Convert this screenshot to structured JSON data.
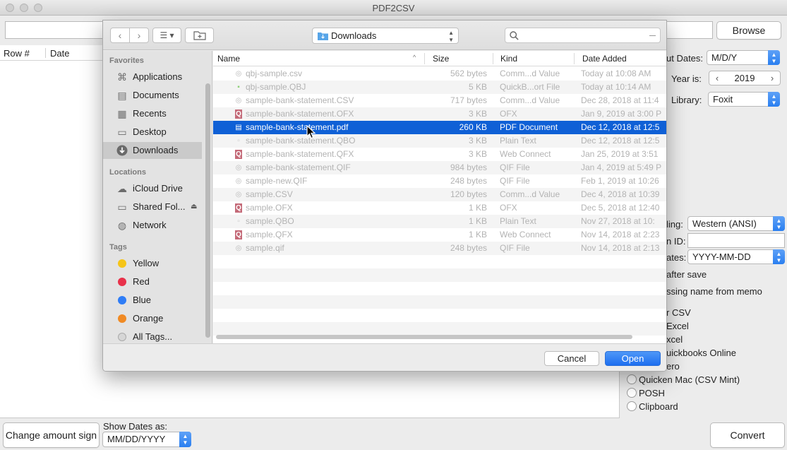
{
  "app": {
    "title": "PDF2CSV",
    "browse_label": "Browse",
    "grid_columns": [
      "Row #",
      "Date"
    ],
    "change_amount_sign_label": "Change amount sign",
    "show_dates_as_label": "Show Dates as:",
    "show_dates_as_value": "MM/DD/YYYY",
    "convert_label": "Convert",
    "settings": {
      "input_dates_label": "ut Dates:",
      "input_dates_value": "M/D/Y",
      "year_label": "Year is:",
      "year_value": "2019",
      "library_label": "Library:",
      "library_value": "Foxit",
      "encoding_label": "ling:",
      "encoding_value": "Western (ANSI)",
      "id_label": "n ID:",
      "id_value": "",
      "dates_label": "ates:",
      "dates_value": "YYYY-MM-DD",
      "after_save_label": "after save",
      "missing_name_label": "ssing name from memo"
    },
    "output_options": [
      "r CSV",
      "Excel",
      "xcel",
      "uickbooks Online",
      "ero",
      "Quicken Mac (CSV Mint)",
      "POSH",
      "Clipboard"
    ]
  },
  "dialog": {
    "location": "Downloads",
    "search_placeholder": "",
    "sidebar": {
      "favorites_title": "Favorites",
      "favorites": [
        {
          "label": "Applications",
          "icon": "applications-icon"
        },
        {
          "label": "Documents",
          "icon": "documents-icon"
        },
        {
          "label": "Recents",
          "icon": "recents-icon"
        },
        {
          "label": "Desktop",
          "icon": "desktop-icon"
        },
        {
          "label": "Downloads",
          "icon": "downloads-icon",
          "selected": true
        }
      ],
      "locations_title": "Locations",
      "locations": [
        {
          "label": "iCloud Drive",
          "icon": "cloud-icon"
        },
        {
          "label": "Shared Fol...",
          "icon": "display-icon"
        },
        {
          "label": "Network",
          "icon": "globe-icon"
        }
      ],
      "tags_title": "Tags",
      "tags": [
        {
          "label": "Yellow",
          "color": "#f5c518"
        },
        {
          "label": "Red",
          "color": "#e8314a"
        },
        {
          "label": "Blue",
          "color": "#2f7df6"
        },
        {
          "label": "Orange",
          "color": "#f08a24"
        },
        {
          "label": "All Tags...",
          "color": "#d6d6d6"
        }
      ]
    },
    "columns": {
      "name": "Name",
      "size": "Size",
      "kind": "Kind",
      "date": "Date Added"
    },
    "files": [
      {
        "name": "qbj-sample.csv",
        "size": "562 bytes",
        "kind": "Comm...d Value",
        "date": "Today at 10:08 AM",
        "icon": "csv-file-icon"
      },
      {
        "name": "qbj-sample.QBJ",
        "size": "5 KB",
        "kind": "QuickB...ort File",
        "date": "Today at 10:14 AM",
        "icon": "qbj-file-icon"
      },
      {
        "name": "sample-bank-statement.CSV",
        "size": "717 bytes",
        "kind": "Comm...d Value",
        "date": "Dec 28, 2018 at 11:4",
        "icon": "csv-file-icon"
      },
      {
        "name": "sample-bank-statement.OFX",
        "size": "3 KB",
        "kind": "OFX",
        "date": "Jan 9, 2019 at 3:00 P",
        "icon": "quicken-file-icon"
      },
      {
        "name": "sample-bank-statement.pdf",
        "size": "260 KB",
        "kind": "PDF Document",
        "date": "Dec 12, 2018 at 12:5",
        "icon": "pdf-file-icon",
        "selected": true
      },
      {
        "name": "sample-bank-statement.QBO",
        "size": "3 KB",
        "kind": "Plain Text",
        "date": "Dec 12, 2018 at 12:5",
        "icon": "text-file-icon"
      },
      {
        "name": "sample-bank-statement.QFX",
        "size": "3 KB",
        "kind": "Web Connect",
        "date": "Jan 25, 2019 at 3:51",
        "icon": "quicken-file-icon"
      },
      {
        "name": "sample-bank-statement.QIF",
        "size": "984 bytes",
        "kind": "QIF File",
        "date": "Jan 4, 2019 at 5:49 P",
        "icon": "csv-file-icon"
      },
      {
        "name": "sample-new.QIF",
        "size": "248 bytes",
        "kind": "QIF File",
        "date": "Feb 1, 2019 at 10:26",
        "icon": "csv-file-icon"
      },
      {
        "name": "sample.CSV",
        "size": "120 bytes",
        "kind": "Comm...d Value",
        "date": "Dec 4, 2018 at 10:39",
        "icon": "csv-file-icon"
      },
      {
        "name": "sample.OFX",
        "size": "1 KB",
        "kind": "OFX",
        "date": "Dec 5, 2018 at 12:40",
        "icon": "quicken-file-icon"
      },
      {
        "name": "sample.QBO",
        "size": "1 KB",
        "kind": "Plain Text",
        "date": "Nov 27, 2018 at 10:",
        "icon": "text-file-icon"
      },
      {
        "name": "sample.QFX",
        "size": "1 KB",
        "kind": "Web Connect",
        "date": "Nov 14, 2018 at 2:23",
        "icon": "quicken-file-icon"
      },
      {
        "name": "sample.qif",
        "size": "248 bytes",
        "kind": "QIF File",
        "date": "Nov 14, 2018 at 2:13",
        "icon": "csv-file-icon"
      }
    ],
    "cancel_label": "Cancel",
    "open_label": "Open",
    "accent_color": "#0f60d6"
  }
}
